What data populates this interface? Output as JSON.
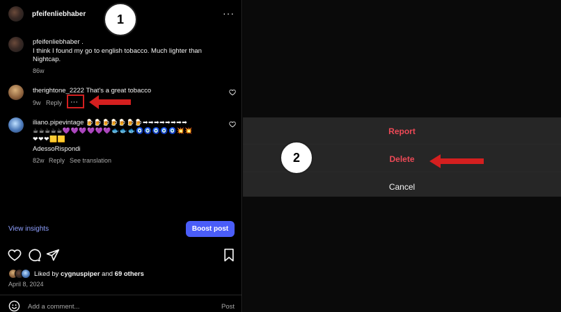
{
  "post": {
    "author": "pfeifenliebhaber",
    "caption_author": "pfeifenliebhaber .",
    "caption_line1": "I think I found my go to english tobacco. Much lighter than",
    "caption_line2": "Nightcap.",
    "caption_time": "86w"
  },
  "comments": [
    {
      "user": "therightone_2222",
      "text": "That's a great tobacco",
      "time": "9w",
      "reply": "Reply",
      "more": "···"
    },
    {
      "user": "iliano.pipevintage",
      "emoji_line1": "🍺🍺🍺🍺🍺🍺🍺➡➡➡➡➡➡➡➡",
      "emoji_line2": "☕☕☕☕☕💜💜💜💜💜💜🐟🐟🐟🧿🧿🧿🧿🧿💥💥",
      "emoji_line3": "❤❤❤🟨🟨",
      "text": "AdessoRispondi",
      "time": "82w",
      "reply": "Reply",
      "translation": "See translation"
    }
  ],
  "actions": {
    "view_insights": "View insights",
    "boost_post": "Boost post"
  },
  "likes": {
    "prefix": "Liked by ",
    "user": "cygnuspiper",
    "joiner": " and ",
    "others": "69 others"
  },
  "date": "April 8, 2024",
  "add_comment": {
    "placeholder": "Add a comment...",
    "post_label": "Post"
  },
  "menu": {
    "report": "Report",
    "delete": "Delete",
    "cancel": "Cancel"
  },
  "annotations": {
    "step1": "1",
    "step2": "2"
  },
  "colors": {
    "accent_blue": "#4a5df9",
    "danger_red": "#ed4956",
    "annotation_red": "#d41f1f"
  }
}
